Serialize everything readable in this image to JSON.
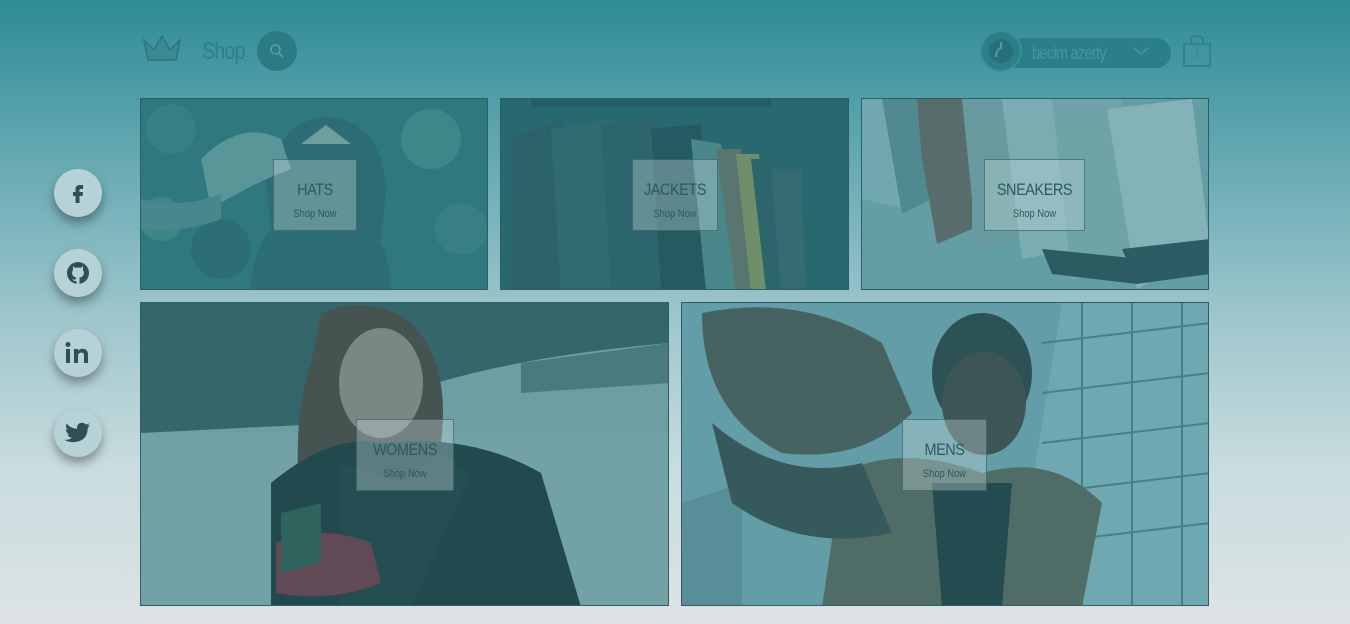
{
  "header": {
    "shop_label": "Shop",
    "user_name": "becim azerty"
  },
  "social": {
    "icons": [
      "facebook-icon",
      "github-icon",
      "linkedin-icon",
      "twitter-icon"
    ]
  },
  "categories": [
    {
      "title": "HATS",
      "cta": "Shop Now"
    },
    {
      "title": "JACKETS",
      "cta": "Shop Now"
    },
    {
      "title": "SNEAKERS",
      "cta": "Shop Now"
    },
    {
      "title": "WOMENS",
      "cta": "Shop Now"
    },
    {
      "title": "MENS",
      "cta": "Shop Now"
    }
  ],
  "colors": {
    "accent": "#2b7a84",
    "background_top": "#2e8b96",
    "background_bottom": "#dde3e4"
  }
}
